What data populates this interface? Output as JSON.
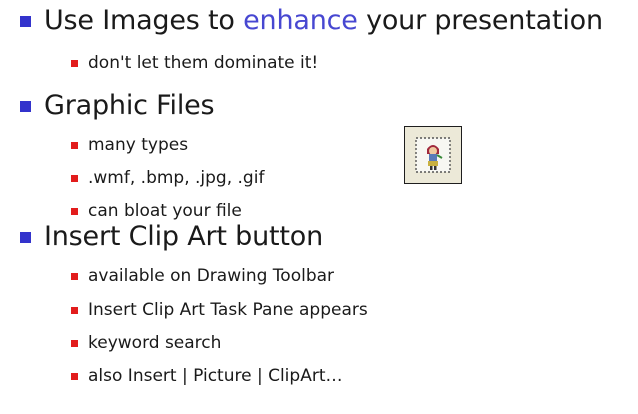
{
  "bullets": {
    "images": {
      "prefix": "Use Images to ",
      "accent": "enhance",
      "suffix": " your presentation",
      "sub": [
        "don't let them dominate it!"
      ]
    },
    "graphic_files": {
      "label": "Graphic Files",
      "sub": [
        "many types",
        ".wmf, .bmp, .jpg, .gif",
        "can bloat your file"
      ]
    },
    "insert_clip_art": {
      "label": "Insert Clip Art button",
      "sub": [
        "available on Drawing Toolbar",
        "Insert Clip Art Task Pane appears",
        "keyword search",
        "also Insert | Picture | ClipArt…"
      ]
    }
  },
  "colors": {
    "level1_bullet": "#3333cc",
    "level2_bullet": "#e21c1c",
    "accent_text": "#4747d1"
  },
  "icons": {
    "clip_art_button": "insert-clip-art-icon"
  }
}
